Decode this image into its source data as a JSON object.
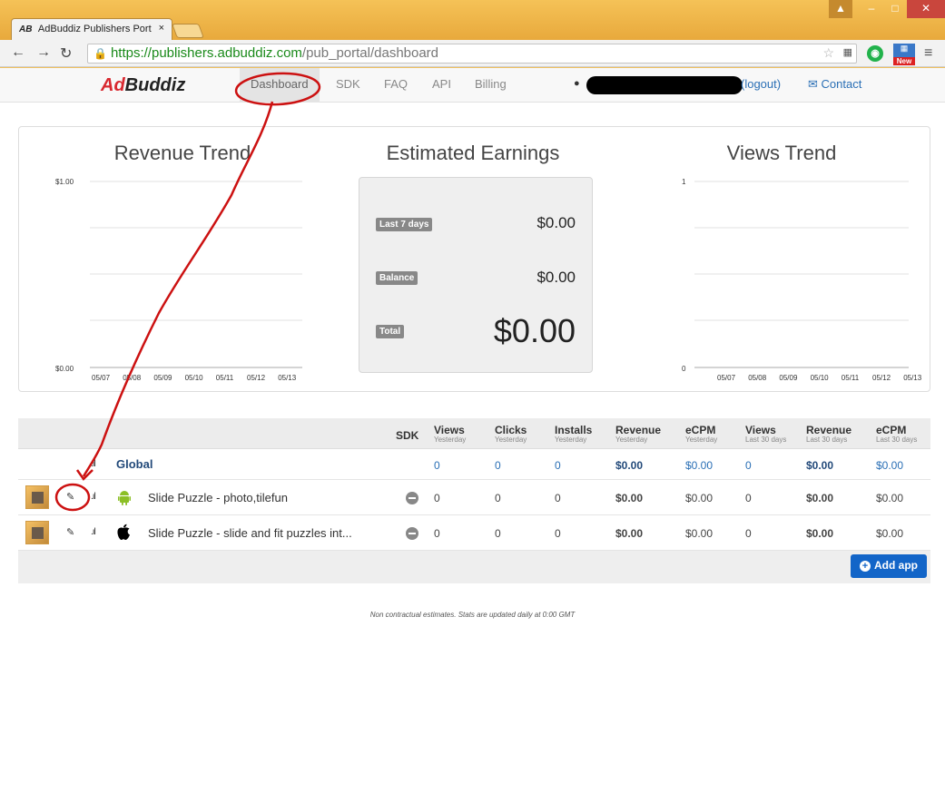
{
  "browser": {
    "tab_title": "AdBuddiz Publishers Port",
    "tab_icon": "AB",
    "tab_close": "×",
    "url_host": "https://publishers.adbuddiz.com",
    "url_path": "/pub_portal/dashboard",
    "ext_new_badge": "New"
  },
  "nav": {
    "brand_ad": "Ad",
    "brand_buddiz": "Buddiz",
    "links": [
      "Dashboard",
      "SDK",
      "FAQ",
      "API",
      "Billing"
    ],
    "logout": "(logout)",
    "contact": "Contact"
  },
  "revenue_trend": {
    "title": "Revenue Trend",
    "y_max_label": "$1.00",
    "y_min_label": "$0.00",
    "dates": [
      "05/07",
      "05/08",
      "05/09",
      "05/10",
      "05/11",
      "05/12",
      "05/13"
    ]
  },
  "earnings": {
    "title": "Estimated Earnings",
    "last7_label": "Last 7 days",
    "last7_value": "$0.00",
    "balance_label": "Balance",
    "balance_value": "$0.00",
    "total_label": "Total",
    "total_value": "$0.00"
  },
  "views_trend": {
    "title": "Views Trend",
    "y_max_label": "1",
    "y_min_label": "0",
    "dates": [
      "05/07",
      "05/08",
      "05/09",
      "05/10",
      "05/11",
      "05/12",
      "05/13"
    ]
  },
  "table": {
    "headers": {
      "sdk": "SDK",
      "views": "Views",
      "views_sub": "Yesterday",
      "clicks": "Clicks",
      "clicks_sub": "Yesterday",
      "installs": "Installs",
      "installs_sub": "Yesterday",
      "revenue": "Revenue",
      "revenue_sub": "Yesterday",
      "ecpm": "eCPM",
      "ecpm_sub": "Yesterday",
      "views30": "Views",
      "views30_sub": "Last 30 days",
      "revenue30": "Revenue",
      "revenue30_sub": "Last 30 days",
      "ecpm30": "eCPM",
      "ecpm30_sub": "Last 30 days"
    },
    "global": {
      "name": "Global",
      "views": "0",
      "clicks": "0",
      "installs": "0",
      "revenue": "$0.00",
      "ecpm": "$0.00",
      "views30": "0",
      "revenue30": "$0.00",
      "ecpm30": "$0.00"
    },
    "apps": [
      {
        "name": "Slide Puzzle - photo,tilefun",
        "platform": "android",
        "views": "0",
        "clicks": "0",
        "installs": "0",
        "revenue": "$0.00",
        "ecpm": "$0.00",
        "views30": "0",
        "revenue30": "$0.00",
        "ecpm30": "$0.00"
      },
      {
        "name": "Slide Puzzle - slide and fit puzzles int...",
        "platform": "apple",
        "views": "0",
        "clicks": "0",
        "installs": "0",
        "revenue": "$0.00",
        "ecpm": "$0.00",
        "views30": "0",
        "revenue30": "$0.00",
        "ecpm30": "$0.00"
      }
    ],
    "add_app": "Add app"
  },
  "footnote": "Non contractual estimates. Stats are updated daily at 0:00 GMT",
  "colors": {
    "brand_red": "#d8282f",
    "link_blue": "#2a6fb5",
    "button_blue": "#1265c8",
    "annotation_red": "#cc1111"
  }
}
